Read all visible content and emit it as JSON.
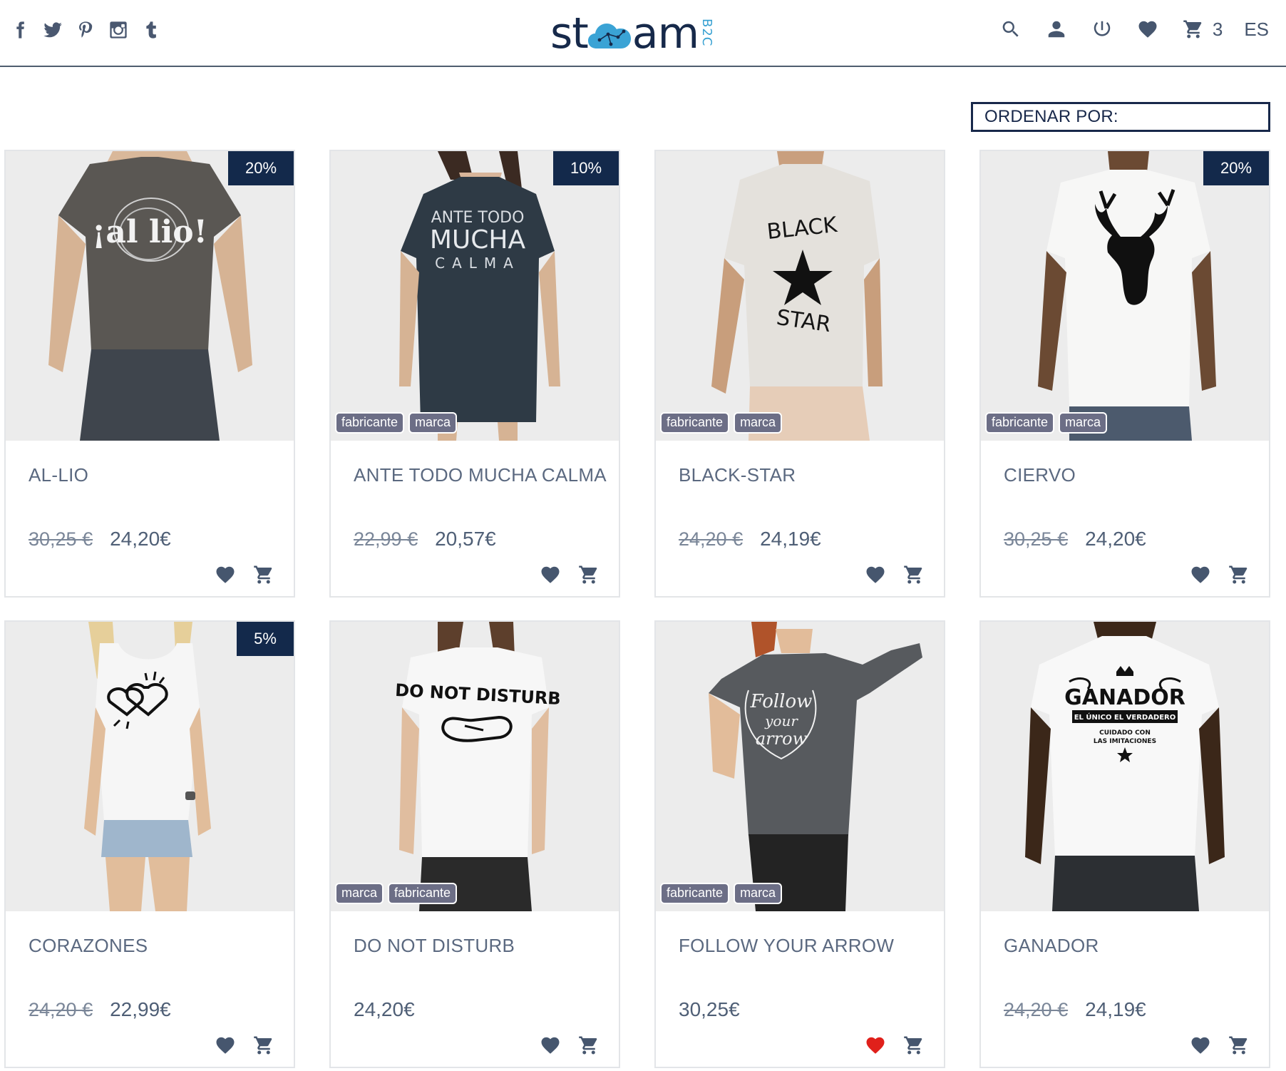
{
  "header": {
    "social": [
      "facebook-icon",
      "twitter-icon",
      "pinterest-icon",
      "instagram-icon",
      "tumblr-icon"
    ],
    "logo": {
      "word_left": "st",
      "word_right": "am",
      "sub": "B2C"
    },
    "actions": [
      "search-icon",
      "user-icon",
      "power-icon",
      "heart-icon",
      "cart-icon"
    ],
    "cart_count": "3",
    "language": "ES"
  },
  "sort": {
    "label": "ORDENAR POR:"
  },
  "colors": {
    "brand": "#13294b",
    "accent": "#38a1d2",
    "tag": "#6c6e86",
    "favorite_active": "#e0201b",
    "text": "#5b6980"
  },
  "products": [
    {
      "name": "AL-LIO",
      "old_price": "30,25 €",
      "price": "24,20€",
      "discount": "20%",
      "tags": [],
      "shirt_print": "¡al lio!",
      "favorite": false
    },
    {
      "name": "ANTE TODO MUCHA CALMA",
      "old_price": "22,99 €",
      "price": "20,57€",
      "discount": "10%",
      "tags": [
        "fabricante",
        "marca"
      ],
      "shirt_print": "ANTE TODO MUCHA CALMA",
      "favorite": false
    },
    {
      "name": "BLACK-STAR",
      "old_price": "24,20 €",
      "price": "24,19€",
      "discount": "",
      "tags": [
        "fabricante",
        "marca"
      ],
      "shirt_print": "BLACK STAR",
      "favorite": false
    },
    {
      "name": "CIERVO",
      "old_price": "30,25 €",
      "price": "24,20€",
      "discount": "20%",
      "tags": [
        "fabricante",
        "marca"
      ],
      "shirt_print": "",
      "favorite": false
    },
    {
      "name": "CORAZONES",
      "old_price": "24,20 €",
      "price": "22,99€",
      "discount": "5%",
      "tags": [],
      "shirt_print": "",
      "favorite": false
    },
    {
      "name": "DO NOT DISTURB",
      "old_price": "",
      "price": "24,20€",
      "discount": "",
      "tags": [
        "marca",
        "fabricante"
      ],
      "shirt_print": "DO NOT DISTURB",
      "favorite": false
    },
    {
      "name": "FOLLOW YOUR ARROW",
      "old_price": "",
      "price": "30,25€",
      "discount": "",
      "tags": [
        "fabricante",
        "marca"
      ],
      "shirt_print": "Follow your arrow",
      "favorite": true
    },
    {
      "name": "GANADOR",
      "old_price": "24,20 €",
      "price": "24,19€",
      "discount": "",
      "tags": [],
      "shirt_print": "GANADOR · EL ÚNICO EL VERDADERO · CUIDADO CON LAS IMITACIONES",
      "favorite": false
    }
  ]
}
